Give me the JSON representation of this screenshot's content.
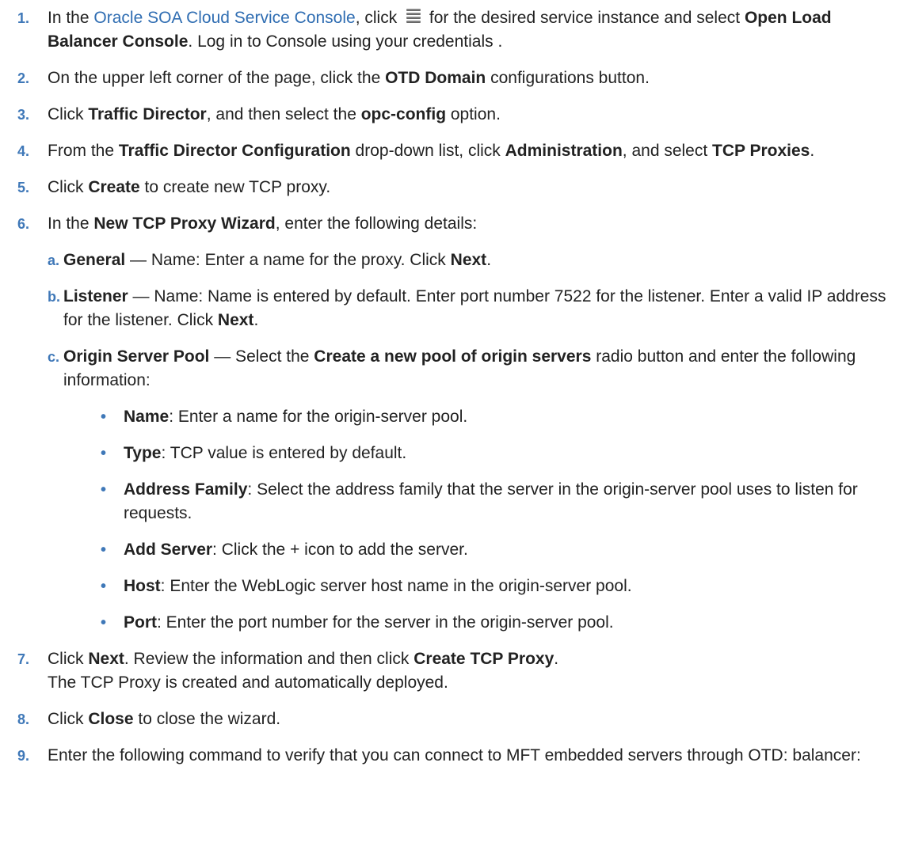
{
  "steps": [
    {
      "num": "1.",
      "t1": "In the ",
      "link": "Oracle SOA Cloud Service Console",
      "t2": ", click ",
      "icon": "hamburger-menu-icon",
      "t3": " for the desired service instance and select ",
      "b1": "Open Load Balancer Console",
      "t4": ". Log in to Console using your credentials ."
    },
    {
      "num": "2.",
      "t1": "On the upper left corner of the page, click the ",
      "b1": "OTD Domain",
      "t2": " configurations button."
    },
    {
      "num": "3.",
      "t1": "Click ",
      "b1": "Traffic Director",
      "t2": ", and then select the ",
      "b2": "opc-config",
      "t3": " option."
    },
    {
      "num": "4.",
      "t1": "From the ",
      "b1": "Traffic Director Configuration",
      "t2": " drop-down list, click ",
      "b2": "Administration",
      "t3": ", and select ",
      "b3": "TCP Proxies",
      "t4": "."
    },
    {
      "num": "5.",
      "t1": "Click ",
      "b1": "Create",
      "t2": " to create new TCP proxy."
    },
    {
      "num": "6.",
      "t1": "In the ",
      "b1": "New TCP Proxy Wizard",
      "t2": ", enter the following details:",
      "subs": [
        {
          "letter": "a.",
          "b1": "General",
          "t1": " — Name: Enter a name for the proxy. Click ",
          "b2": "Next",
          "t2": "."
        },
        {
          "letter": "b.",
          "b1": "Listener",
          "t1": " — Name: Name is entered by default. Enter port number 7522 for the listener. Enter a valid IP address for the listener. Click ",
          "b2": "Next",
          "t2": "."
        },
        {
          "letter": "c.",
          "b1": "Origin Server Pool",
          "t1": " — Select the ",
          "b2": "Create a new pool of origin servers",
          "t2": " radio button and enter the following information:",
          "bullets": [
            {
              "dot": "•",
              "b": "Name",
              "t": ": Enter a name for the origin-server pool."
            },
            {
              "dot": "•",
              "b": "Type",
              "t": ": TCP value is entered by default."
            },
            {
              "dot": "•",
              "b": "Address Family",
              "t": ": Select the address family that the server in the origin-server pool uses to listen for requests."
            },
            {
              "dot": "•",
              "b": "Add Server",
              "t": ": Click the + icon to add the server."
            },
            {
              "dot": "•",
              "b": "Host",
              "t": ": Enter the WebLogic server host name in the origin-server pool."
            },
            {
              "dot": "•",
              "b": "Port",
              "t": ": Enter the port number for the server in the origin-server pool."
            }
          ]
        }
      ]
    },
    {
      "num": "7.",
      "t1": "Click ",
      "b1": "Next",
      "t2": ". Review the information and then click ",
      "b2": "Create TCP Proxy",
      "t3": ".",
      "followup": "The TCP Proxy is created and automatically deployed."
    },
    {
      "num": "8.",
      "t1": "Click ",
      "b1": "Close",
      "t2": " to close the wizard."
    },
    {
      "num": "9.",
      "t1": "Enter the following command to verify that you can connect to MFT embedded servers through OTD: balancer:"
    }
  ]
}
